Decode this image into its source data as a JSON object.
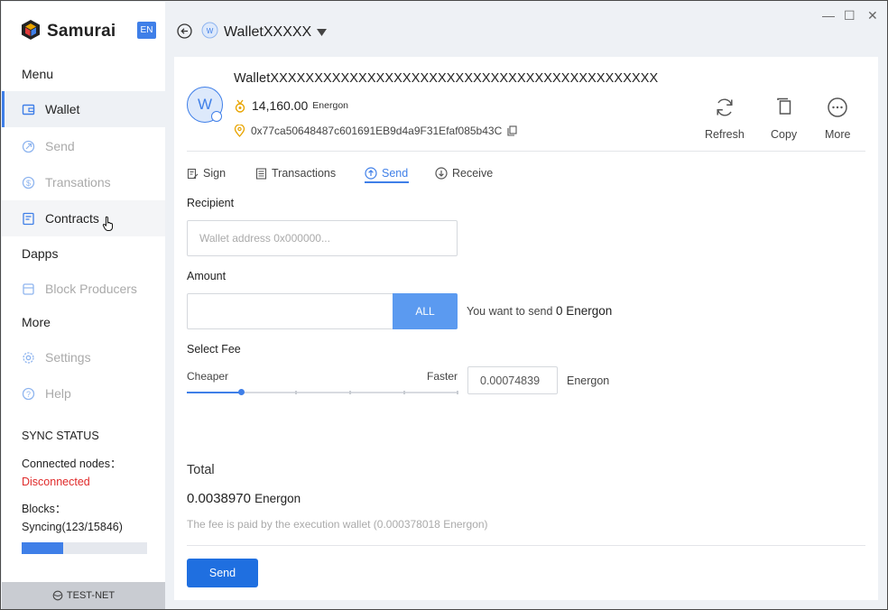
{
  "app": {
    "name": "Samurai",
    "lang": "EN",
    "window_controls": [
      "—",
      "☐",
      "✕"
    ]
  },
  "sidebar": {
    "menu_header": "Menu",
    "items": [
      {
        "label": "Wallet",
        "icon": "wallet-icon",
        "state": "active"
      },
      {
        "label": "Send",
        "icon": "send-icon",
        "state": "disabled"
      },
      {
        "label": "Transations",
        "icon": "dollar-icon",
        "state": "disabled"
      },
      {
        "label": "Contracts",
        "icon": "contract-icon",
        "state": "hover"
      },
      {
        "label": "Dapps",
        "icon": "",
        "state": "normal"
      },
      {
        "label": "Block Producers",
        "icon": "block-icon",
        "state": "disabled"
      },
      {
        "label": "More",
        "icon": "",
        "state": "header"
      },
      {
        "label": "Settings",
        "icon": "gear-icon",
        "state": "disabled"
      },
      {
        "label": "Help",
        "icon": "help-icon",
        "state": "disabled"
      }
    ],
    "sync": {
      "title": "SYNC STATUS",
      "nodes_label": "Connected nodes：",
      "nodes_value": "Disconnected",
      "blocks_label": "Blocks：",
      "blocks_value": "Syncing(123/15846)",
      "progress_fraction": 0.33
    },
    "network": "TEST-NET"
  },
  "header": {
    "wallet_name": "WalletXXXXX"
  },
  "wallet": {
    "avatar_letter": "W",
    "full_name": "WalletXXXXXXXXXXXXXXXXXXXXXXXXXXXXXXXXXXXXXXXXXXXX",
    "balance": "14,160.00",
    "balance_unit": "Energon",
    "address": "0x77ca50648487c601691EB9d4a9F31Efaf085b43C"
  },
  "actions": [
    {
      "label": "Refresh",
      "icon": "refresh-icon"
    },
    {
      "label": "Copy",
      "icon": "copy-icon"
    },
    {
      "label": "More",
      "icon": "more-icon"
    }
  ],
  "tabs": [
    {
      "label": "Sign",
      "icon": "sign-icon"
    },
    {
      "label": "Transactions",
      "icon": "list-icon"
    },
    {
      "label": "Send",
      "icon": "upload-icon",
      "active": true
    },
    {
      "label": "Receive",
      "icon": "download-icon"
    }
  ],
  "form": {
    "recipient_label": "Recipient",
    "recipient_placeholder": "Wallet address 0x000000...",
    "amount_label": "Amount",
    "amount_value": "",
    "all_label": "ALL",
    "want_prefix": "You want to send",
    "want_amount": "0 Energon",
    "fee_label": "Select Fee",
    "fee_cheaper": "Cheaper",
    "fee_faster": "Faster",
    "fee_position": 0.2,
    "fee_value": "0.00074839",
    "fee_unit": "Energon"
  },
  "total": {
    "label": "Total",
    "value": "0.0038970",
    "unit": "Energon",
    "note": "The fee is paid by the execution wallet (0.000378018 Energon)"
  },
  "send_button": "Send",
  "colors": {
    "accent": "#3f7fe8",
    "danger": "#e02b2b",
    "balance_icon": "#e8a400"
  }
}
